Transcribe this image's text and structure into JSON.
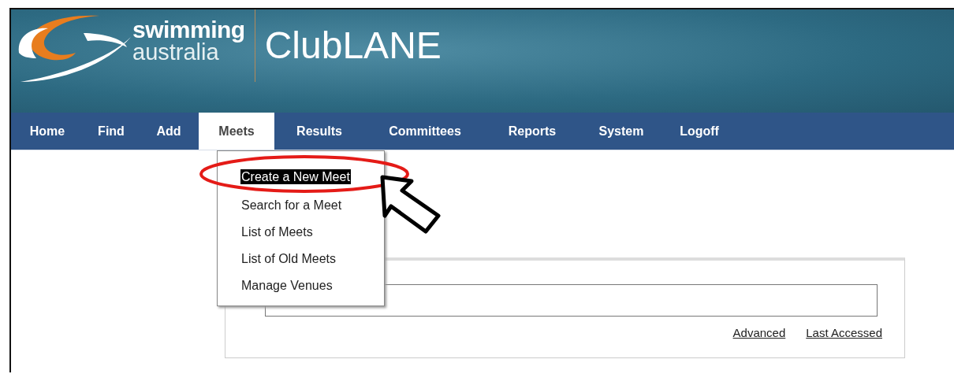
{
  "header": {
    "logo_top": "swimming",
    "logo_bottom": "australia",
    "title": "ClubLANE"
  },
  "nav": [
    {
      "label": "Home",
      "selected": false
    },
    {
      "label": "Find",
      "selected": false
    },
    {
      "label": "Add",
      "selected": false
    },
    {
      "label": "Meets",
      "selected": true
    },
    {
      "label": "Results",
      "selected": false
    },
    {
      "label": "Committees",
      "selected": false
    },
    {
      "label": "Reports",
      "selected": false
    },
    {
      "label": "System",
      "selected": false
    },
    {
      "label": "Logoff",
      "selected": false
    }
  ],
  "dropdown": [
    {
      "label": "Create a New Meet",
      "selected": true
    },
    {
      "label": "Search for a Meet",
      "selected": false
    },
    {
      "label": "List of Meets",
      "selected": false
    },
    {
      "label": "List of Old Meets",
      "selected": false
    },
    {
      "label": "Manage Venues",
      "selected": false
    }
  ],
  "search": {
    "links": [
      "Advanced",
      "Last Accessed"
    ]
  }
}
